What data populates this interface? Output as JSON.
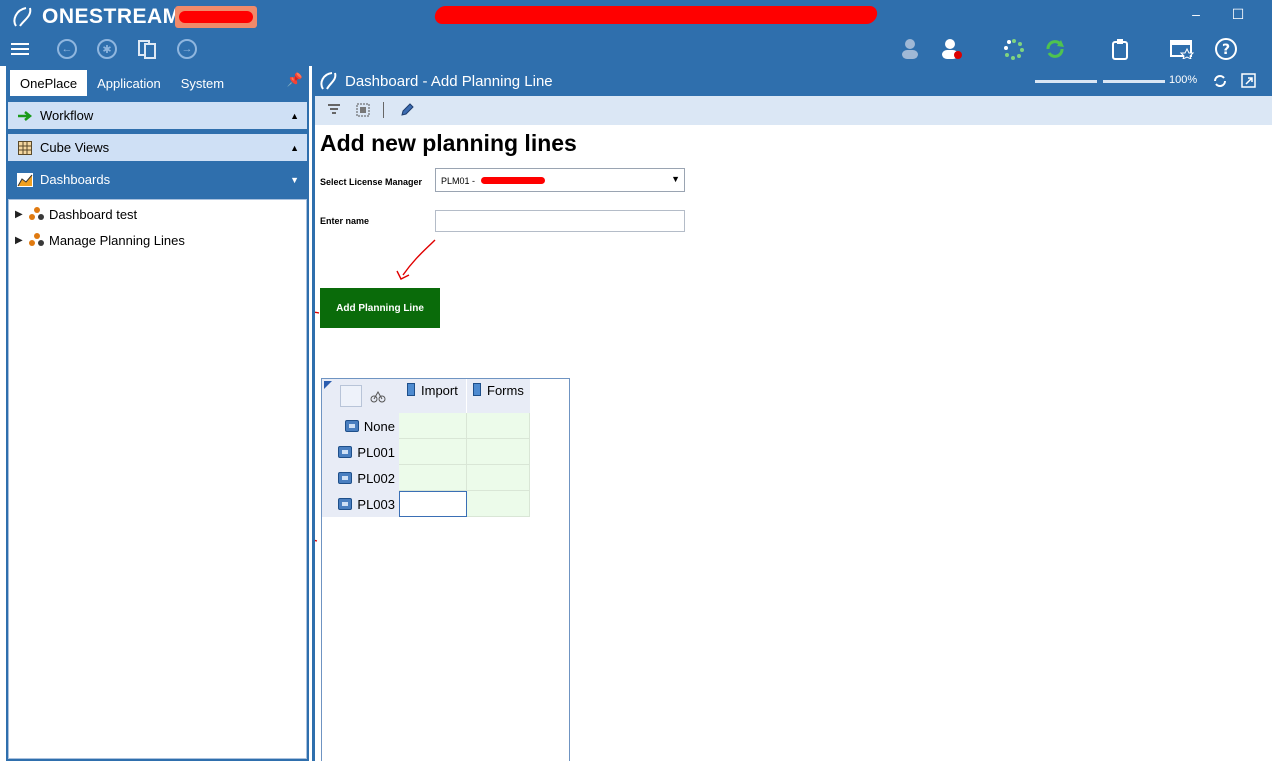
{
  "app": {
    "brand": "ONESTREAM",
    "colors": {
      "chrome": "#2f6fad",
      "accent_light": "#cfe0f5",
      "button_green": "#0a6b0a",
      "cell_green": "#ecfbea",
      "annotation_red": "#e00000"
    }
  },
  "window": {
    "minimize": "–",
    "maximize": "☐"
  },
  "left_panel": {
    "tabs": [
      {
        "label": "OnePlace",
        "active": true
      },
      {
        "label": "Application",
        "active": false
      },
      {
        "label": "System",
        "active": false
      }
    ],
    "sections": [
      {
        "label": "Workflow",
        "icon": "arrow-right-icon",
        "caret": "▲"
      },
      {
        "label": "Cube Views",
        "icon": "grid-icon",
        "caret": "▲"
      },
      {
        "label": "Dashboards",
        "icon": "chart-icon",
        "caret": "▼"
      }
    ],
    "tree": [
      {
        "label": "Dashboard test"
      },
      {
        "label": "Manage Planning Lines"
      }
    ]
  },
  "dashboard": {
    "title": "Dashboard - Add Planning Line",
    "zoom": "100%",
    "zoom_fraction": 0.5,
    "content": {
      "heading": "Add new planning lines",
      "license_label": "Select License Manager",
      "license_value": "PLM01 -",
      "name_label": "Enter name",
      "name_value": "",
      "add_button": "Add Planning Line",
      "grid": {
        "columns": [
          "Import",
          "Forms"
        ],
        "rows": [
          "None",
          "PL001",
          "PL002",
          "PL003"
        ]
      }
    }
  }
}
